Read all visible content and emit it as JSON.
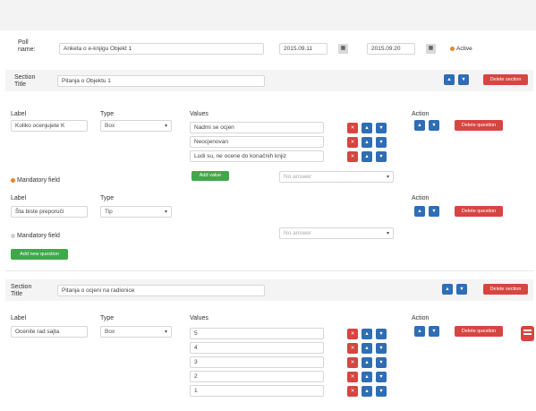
{
  "poll": {
    "name_label": "Poll name:",
    "name_value": "Anketa o e-knjigu Objekt 1",
    "start_date": "2015.09.11",
    "end_date": "2015.09.20",
    "active_label": "Active",
    "calendar_icon": "calendar-icon"
  },
  "section1": {
    "title_label": "Section Title",
    "title_value": "Pitanja o Objektu 1",
    "question1": {
      "label_header": "Label",
      "type_header": "Type",
      "values_header": "Values",
      "action_header": "Action",
      "label_value": "Koliko ocenjujete K",
      "type_value": "Box",
      "values": [
        "Nadmi se ocjen",
        "Neocjenovan",
        "Ludi su, ne ocene do konačnih knjiz"
      ],
      "add_value_label": "Add value",
      "no_answer_placeholder": "No answer",
      "mandatory_label": "Mandatory field",
      "delete_question_label": "Delete question"
    },
    "question2": {
      "label_header": "Label",
      "type_header": "Type",
      "action_header": "Action",
      "label_value": "Šta biste preporuči",
      "type_value": "Tip",
      "no_answer_placeholder": "No answer",
      "mandatory_label": "Mandatory field",
      "add_question_label": "Add new question",
      "delete_question_label": "Delete question"
    },
    "delete_section_label": "Delete section"
  },
  "section2": {
    "title_label": "Section Title",
    "title_value": "Pitanja o ocjeni na radionice",
    "delete_section_label": "Delete section",
    "question1": {
      "label_header": "Label",
      "type_header": "Type",
      "values_header": "Values",
      "action_header": "Action",
      "label_value": "Ocenite rad sajta",
      "type_value": "Box",
      "values": [
        "5",
        "4",
        "3",
        "2",
        "1"
      ],
      "delete_question_label": "Delete question"
    }
  },
  "colors": {
    "blue": "#2f6db5",
    "red": "#d64541",
    "green": "#3fa94a",
    "orange": "#e8842f"
  }
}
